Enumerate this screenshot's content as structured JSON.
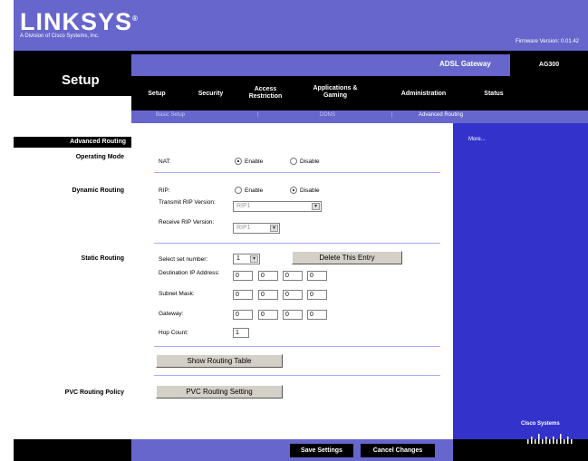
{
  "brand": {
    "logo": "LINKSYS",
    "logo_mark": "®",
    "subtitle": "A Division of Cisco Systems, Inc.",
    "firmware": "Firmware Version: 0.01.42"
  },
  "product": {
    "name": "ADSL Gateway",
    "model": "AG300"
  },
  "page_title": "Setup",
  "tabs": [
    {
      "label": "Setup",
      "active": true
    },
    {
      "label": "Security"
    },
    {
      "label": "Access Restriction"
    },
    {
      "label": "Applications & Gaming"
    },
    {
      "label": "Administration"
    },
    {
      "label": "Status"
    }
  ],
  "subtabs": [
    {
      "label": "Basic Setup"
    },
    {
      "label": "|"
    },
    {
      "label": "DDNS"
    },
    {
      "label": "|"
    },
    {
      "label": "Advanced Routing",
      "active": true
    }
  ],
  "sidebar": {
    "header": "Advanced Routing",
    "operating_mode": "Operating Mode",
    "dynamic_routing": "Dynamic Routing",
    "static_routing": "Static Routing",
    "pvc_routing_policy": "PVC Routing Policy"
  },
  "more_link": "More...",
  "nat": {
    "label": "NAT:",
    "enable": "Enable",
    "disable": "Disable",
    "selected": "Enable"
  },
  "rip": {
    "label": "RIP:",
    "enable": "Enable",
    "disable": "Disable",
    "selected": "Disable",
    "transmit_label": "Transmit RIP Version:",
    "transmit_value": "RIP1",
    "receive_label": "Receive RIP Version:",
    "receive_value": "RIP1"
  },
  "static": {
    "select_set_label": "Select set number:",
    "select_set_value": "1",
    "delete_button": "Delete This Entry",
    "dest_ip_label": "Destination IP Address:",
    "dest_ip": [
      "0",
      "0",
      "0",
      "0"
    ],
    "subnet_label": "Subnet Mask:",
    "subnet": [
      "0",
      "0",
      "0",
      "0"
    ],
    "gateway_label": "Gateway:",
    "gateway": [
      "0",
      "0",
      "0",
      "0"
    ],
    "hop_label": "Hop Count:",
    "hop_value": "1",
    "show_table_button": "Show Routing Table"
  },
  "pvc": {
    "button": "PVC Routing Setting"
  },
  "footer": {
    "save": "Save Settings",
    "cancel": "Cancel Changes",
    "cisco": "Cisco Systems"
  }
}
